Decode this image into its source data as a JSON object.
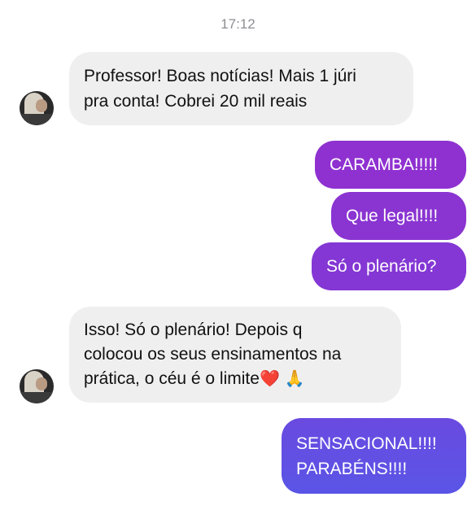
{
  "conversation": {
    "timestamp": "17:12",
    "messages": [
      {
        "direction": "incoming",
        "lines": [
          "Professor! Boas notícias! Mais 1 júri",
          "pra conta! Cobrei 20 mil reais"
        ]
      },
      {
        "direction": "outgoing",
        "lines": [
          "CARAMBA!!!!!"
        ]
      },
      {
        "direction": "outgoing",
        "lines": [
          "Que legal!!!!"
        ]
      },
      {
        "direction": "outgoing",
        "lines": [
          "Só o plenário?"
        ]
      },
      {
        "direction": "incoming",
        "lines": [
          "Isso! Só o plenário! Depois q",
          "colocou os seus ensinamentos na",
          "prática, o céu é o limite"
        ],
        "emojis": [
          "❤️",
          "🙏"
        ]
      },
      {
        "direction": "outgoing",
        "lines": [
          "SENSACIONAL!!!!",
          "PARABÉNS!!!!"
        ]
      }
    ]
  },
  "colors": {
    "incoming_bubble": "#efefef",
    "outgoing_purple": "#8a34d1",
    "outgoing_gradient_end": "#5a55e6",
    "timestamp": "#8e8e93"
  }
}
